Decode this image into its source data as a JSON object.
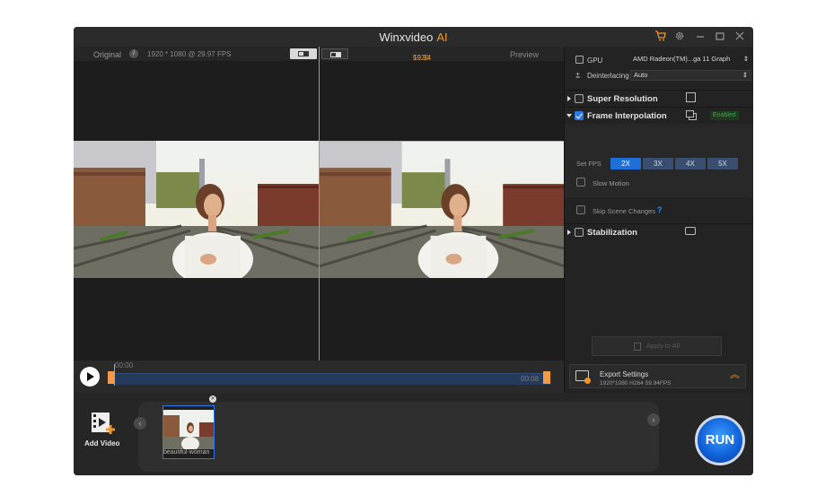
{
  "app": {
    "title": "Winxvideo",
    "title_suffix": "AI"
  },
  "preview": {
    "original_label": "Original",
    "original_info": "1920 * 1080 @ 29.97 FPS",
    "output_info_res": "1920 * 1080 @ ",
    "output_info_fps": "59.94 FPS",
    "preview_label": "Preview"
  },
  "timeline": {
    "start": "00:00",
    "end": "00:08"
  },
  "settings": {
    "gpu_label": "GPU",
    "gpu_value": "AMD Radeon(TM)...ga 11 Graph",
    "deinterlacing_label": "Deinterlacing",
    "deinterlacing_value": "Auto",
    "super_resolution": "Super Resolution",
    "frame_interpolation": "Frame Interpolation",
    "enabled_badge": "Enabled",
    "set_fps_label": "Set FPS",
    "fps_options": [
      "2X",
      "3X",
      "4X",
      "5X"
    ],
    "slow_motion": "Slow Motion",
    "skip_scene_changes": "Skip Scene Changes",
    "help": "?",
    "stabilization": "Stabilization",
    "apply_to_all": "Apply to All"
  },
  "export": {
    "title": "Export Settings",
    "details": "1920*1080  H264  59.94FPS"
  },
  "bottom": {
    "add_video": "Add Video",
    "file_name": "beautiful-woman",
    "run": "RUN"
  },
  "colors": {
    "accent": "#f0962d",
    "blue": "#1f6fd8",
    "enabled_green": "#3aa845"
  }
}
